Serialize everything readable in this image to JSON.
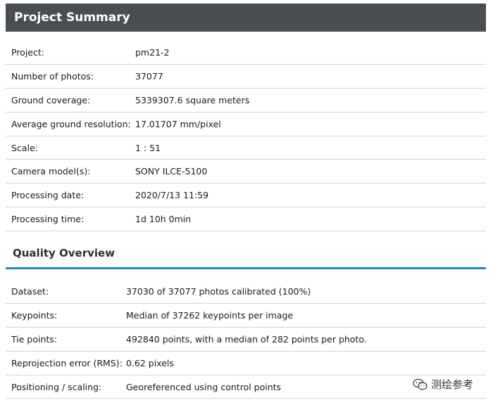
{
  "summary": {
    "title": "Project Summary",
    "rows": [
      {
        "label": "Project:",
        "value": "pm21-2"
      },
      {
        "label": "Number of photos:",
        "value": "37077"
      },
      {
        "label": "Ground coverage:",
        "value": "5339307.6 square meters"
      },
      {
        "label": "Average ground resolution:",
        "value": "17.01707 mm/pixel"
      },
      {
        "label": "Scale:",
        "value": "1 : 51"
      },
      {
        "label": "Camera model(s):",
        "value": "SONY ILCE-5100"
      },
      {
        "label": "Processing date:",
        "value": "2020/7/13 11:59"
      },
      {
        "label": "Processing time:",
        "value": "1d 10h 0min"
      }
    ]
  },
  "quality": {
    "title": "Quality Overview",
    "rows": [
      {
        "label": "Dataset:",
        "value": "37030 of 37077 photos calibrated (100%)"
      },
      {
        "label": "Keypoints:",
        "value": "Median of 37262 keypoints per image"
      },
      {
        "label": "Tie points:",
        "value": "492840 points, with a median of 282 points per photo."
      },
      {
        "label": "Reprojection error (RMS):",
        "value": "0.62 pixels"
      },
      {
        "label": "Positioning / scaling:",
        "value": "Georeferenced using control points"
      }
    ]
  },
  "watermark": {
    "text": "测绘参考",
    "icon": "wechat-icon"
  }
}
